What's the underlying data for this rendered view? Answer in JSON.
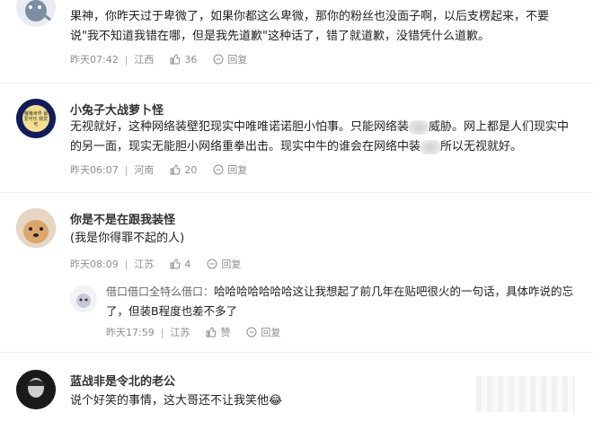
{
  "comments": [
    {
      "name": "",
      "text": "果神，你昨天过于卑微了，如果你都这么卑微，那你的粉丝也没面子啊，以后支楞起来，不要说\"我不知道我错在哪，但是我先道歉\"这种话了，错了就道歉，没错凭什么道歉。",
      "time": "昨天07:42",
      "location": "江西",
      "likes": "36",
      "reply_label": "回复"
    },
    {
      "name": "小兔子大战萝卜怪",
      "text_part1": "无视就好，这种网络装壁犯现实中唯唯诺诺胆小怕事。只能网络装",
      "text_part2": "威胁。网上都是人们现实中的另一面，现实无能胆小网络重拳出击。现实中牛的谁会在网络中装",
      "text_part3": "所以无视就好。",
      "avatar_text": "猪猪世界 最爱可乐 我爱吃",
      "time": "昨天06:07",
      "location": "河南",
      "likes": "20",
      "reply_label": "回复"
    },
    {
      "name": "你是不是在跟我装怪",
      "text": "(我是你得罪不起的人)",
      "time": "昨天08:09",
      "location": "江苏",
      "likes": "4",
      "reply_label": "回复",
      "reply": {
        "name": "借口借口全特么借口：",
        "text": "哈哈哈哈哈哈哈这让我想起了前几年在贴吧很火的一句话，具体咋说的忘了，但装B程度也差不多了",
        "time": "昨天17:59",
        "location": "江苏",
        "like_label": "赞",
        "reply_label": "回复"
      }
    },
    {
      "name": "蓝战非是令北的老公",
      "text": "说个好笑的事情，这大哥还不让我笑他😂"
    }
  ],
  "icons": {
    "like": "thumbs-up-icon",
    "reply": "comment-bubble-icon"
  },
  "colors": {
    "meta": "#8e8e8e",
    "name": "#333333",
    "divider": "#eeeeee"
  }
}
